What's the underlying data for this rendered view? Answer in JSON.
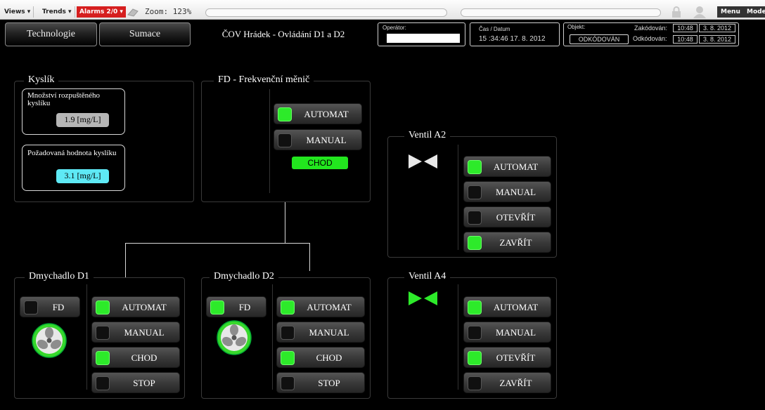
{
  "toolbar": {
    "views": "Views ▾",
    "trends": "Trends ▾",
    "alarms": "Alarms 2/0 ▾",
    "zoom": "Zoom: 123%",
    "menu": "Menu",
    "mode": "Mode"
  },
  "header": {
    "tab_technologie": "Technologie",
    "tab_sumace": "Sumace",
    "title": "ČOV Hrádek - Ovládání D1 a D2",
    "operator_label": "Operátor:",
    "operator_value": "",
    "datetime_label": "Čas / Datum",
    "datetime_value": "15 :34:46   17. 8. 2012",
    "object_label": "Objekt:",
    "object_status": "ODKÓDOVÁN",
    "coded_label": "Zakódován:",
    "coded_time": "10:48",
    "coded_date": "3. 8. 2012",
    "decoded_label": "Odkódován:",
    "decoded_time": "10:48",
    "decoded_date": "3. 8. 2012"
  },
  "oxygen": {
    "title": "Kyslík",
    "dissolved_label": "Množství rozpuštěného kyslíku",
    "dissolved_value": "1.9 [mg/L]",
    "setpoint_label": "Požadovaná hodnota kyslíku",
    "setpoint_value": "3.1 [mg/L]"
  },
  "fd": {
    "title": "FD - Frekvenční měnič",
    "automat": "AUTOMAT",
    "manual": "MANUAL",
    "chod": "CHOD"
  },
  "d1": {
    "title": "Dmychadlo D1",
    "fd": "FD",
    "automat": "AUTOMAT",
    "manual": "MANUAL",
    "chod": "CHOD",
    "stop": "STOP"
  },
  "d2": {
    "title": "Dmychadlo D2",
    "fd": "FD",
    "automat": "AUTOMAT",
    "manual": "MANUAL",
    "chod": "CHOD",
    "stop": "STOP"
  },
  "a2": {
    "title": "Ventil A2",
    "automat": "AUTOMAT",
    "manual": "MANUAL",
    "open": "OTEVŘÍT",
    "close": "ZAVŘÍT"
  },
  "a4": {
    "title": "Ventil A4",
    "automat": "AUTOMAT",
    "manual": "MANUAL",
    "open": "OTEVŘÍT",
    "close": "ZAVŘÍT"
  },
  "colors": {
    "led_on": "#2dea2a",
    "alarm_red": "#d61f1f",
    "value_gray": "#b6b6b6",
    "value_cyan": "#5ee9f5"
  }
}
